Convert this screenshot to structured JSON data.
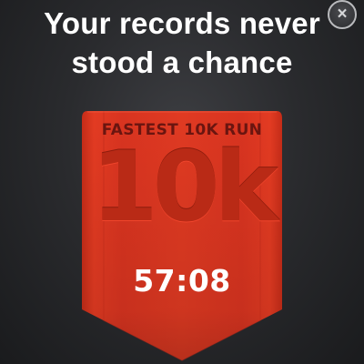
{
  "header": {
    "headline_line1": "Your records never",
    "headline_line2": "stood a chance",
    "close_glyph": "×"
  },
  "badge": {
    "label": "FASTEST 10K RUN",
    "distance": "10k",
    "time": "57:08"
  },
  "colors": {
    "ribbon_red": "#e13a22",
    "ribbon_dark": "#b12a17",
    "background": "#2a2b2e"
  },
  "icons": {
    "close": "close-icon"
  }
}
